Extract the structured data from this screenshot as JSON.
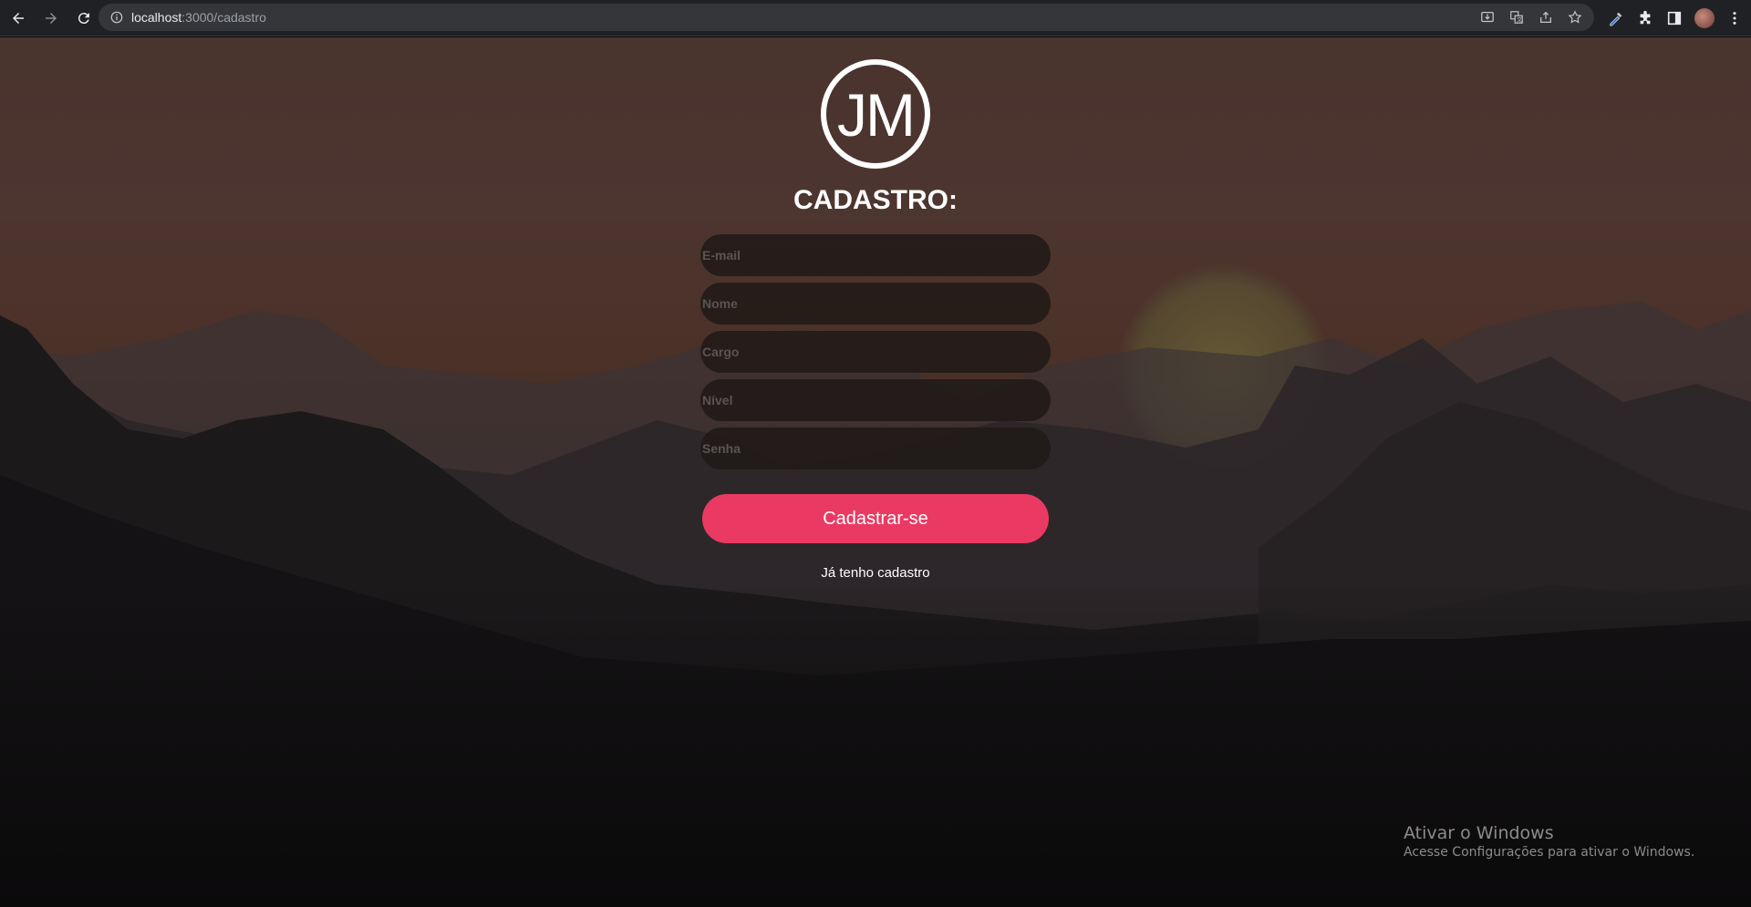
{
  "browser": {
    "url_host": "localhost",
    "url_path": ":3000/cadastro",
    "icons": [
      "back-icon",
      "forward-icon",
      "reload-icon",
      "info-icon",
      "install-icon",
      "translate-icon",
      "share-icon",
      "bookmark-star-icon",
      "eyedropper-icon",
      "extensions-icon",
      "side-panel-icon",
      "profile-avatar",
      "menu-icon"
    ]
  },
  "logo": {
    "text": "JM"
  },
  "form": {
    "title": "CADASTRO:",
    "fields": {
      "email": {
        "placeholder": "E-mail",
        "value": ""
      },
      "nome": {
        "placeholder": "Nome",
        "value": ""
      },
      "cargo": {
        "placeholder": "Cargo",
        "value": ""
      },
      "nivel": {
        "placeholder": "Nível",
        "value": ""
      },
      "senha": {
        "placeholder": "Senha",
        "value": ""
      }
    },
    "submit_label": "Cadastrar-se",
    "login_link": "Já tenho cadastro"
  },
  "watermark": {
    "title": "Ativar o Windows",
    "subtitle": "Acesse Configurações para ativar o Windows."
  },
  "colors": {
    "accent": "#ea3a63",
    "chrome_bg": "#202124",
    "field_bg": "#1e1816"
  }
}
